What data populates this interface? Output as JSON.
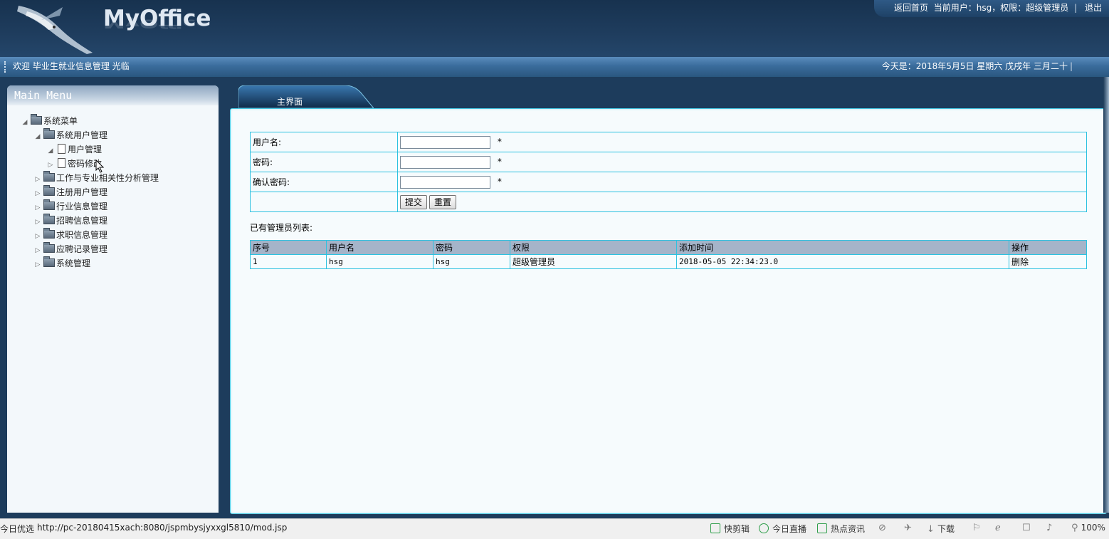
{
  "header": {
    "logo_text": "MyOffice",
    "links": {
      "home": "返回首页",
      "current_user": "当前用户：hsg，权限：超级管理员",
      "logout": "退出"
    }
  },
  "welcome_bar": {
    "welcome": "欢迎 毕业生就业信息管理 光临",
    "date": "今天是：2018年5月5日 星期六 戊戌年 三月二十"
  },
  "sidebar": {
    "title": "Main Menu",
    "tree": [
      {
        "label": "系统菜单",
        "level": 0,
        "expanded": true,
        "type": "folder"
      },
      {
        "label": "系统用户管理",
        "level": 1,
        "expanded": true,
        "type": "folder"
      },
      {
        "label": "用户管理",
        "level": 2,
        "expanded": true,
        "type": "page"
      },
      {
        "label": "密码修改",
        "level": 2,
        "expanded": false,
        "type": "page"
      },
      {
        "label": "工作与专业相关性分析管理",
        "level": 1,
        "expanded": false,
        "type": "folder"
      },
      {
        "label": "注册用户管理",
        "level": 1,
        "expanded": false,
        "type": "folder"
      },
      {
        "label": "行业信息管理",
        "level": 1,
        "expanded": false,
        "type": "folder"
      },
      {
        "label": "招聘信息管理",
        "level": 1,
        "expanded": false,
        "type": "folder"
      },
      {
        "label": "求职信息管理",
        "level": 1,
        "expanded": false,
        "type": "folder"
      },
      {
        "label": "应聘记录管理",
        "level": 1,
        "expanded": false,
        "type": "folder"
      },
      {
        "label": "系统管理",
        "level": 1,
        "expanded": false,
        "type": "folder"
      }
    ]
  },
  "main": {
    "tab_label": "主界面",
    "form": {
      "username_label": "用户名:",
      "password_label": "密码:",
      "confirm_label": "确认密码:",
      "required_mark": "*",
      "username_value": "",
      "password_value": "",
      "confirm_value": "",
      "submit_label": "提交",
      "reset_label": "重置"
    },
    "list_title": "已有管理员列表:",
    "table": {
      "headers": [
        "序号",
        "用户名",
        "密码",
        "权限",
        "添加时间",
        "操作"
      ],
      "rows": [
        [
          "1",
          "hsg",
          "hsg",
          "超级管理员",
          "2018-05-05 22:34:23.0",
          "删除"
        ]
      ]
    }
  },
  "statusbar": {
    "left_text": "今日优选",
    "url": "http://pc-20180415xach:8080/jspmbysjyxxgl5810/mod.jsp",
    "items": [
      "快剪辑",
      "今日直播",
      "热点资讯",
      "下载",
      "100%"
    ]
  },
  "colors": {
    "header_bg": "#1f3d5e",
    "table_border": "#2dc1e0",
    "table_header_bg": "#a5b4c9",
    "content_bg": "#f6fbfd"
  }
}
